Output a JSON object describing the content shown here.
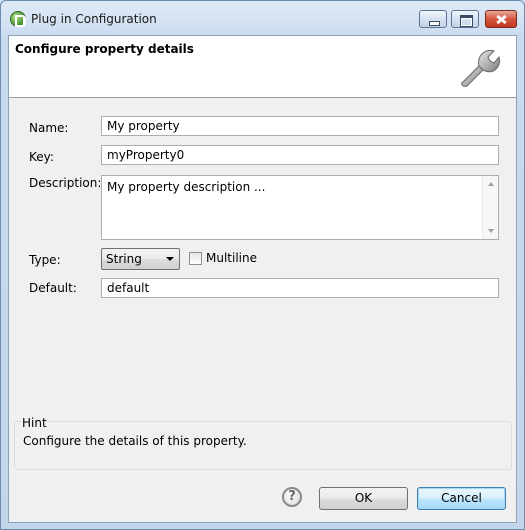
{
  "window": {
    "title": "Plug in Configuration"
  },
  "banner": {
    "title": "Configure property details",
    "icon": "wrench-icon"
  },
  "form": {
    "name_label": "Name:",
    "name_value": "My property",
    "key_label": "Key:",
    "key_value": "myProperty0",
    "description_label": "Description:",
    "description_value": "My property description ...",
    "type_label": "Type:",
    "type_value": "String",
    "multiline_label": "Multiline",
    "multiline_checked": false,
    "default_label": "Default:",
    "default_value": "default"
  },
  "hint": {
    "title": "Hint",
    "text": "Configure the details of this property."
  },
  "buttons": {
    "help": "?",
    "ok": "OK",
    "cancel": "Cancel"
  },
  "colors": {
    "title_bar": "#c9daee",
    "close_button": "#c2381f",
    "dialog_background": "#f0f0f0",
    "focused_button_border": "#3c7fb1"
  }
}
